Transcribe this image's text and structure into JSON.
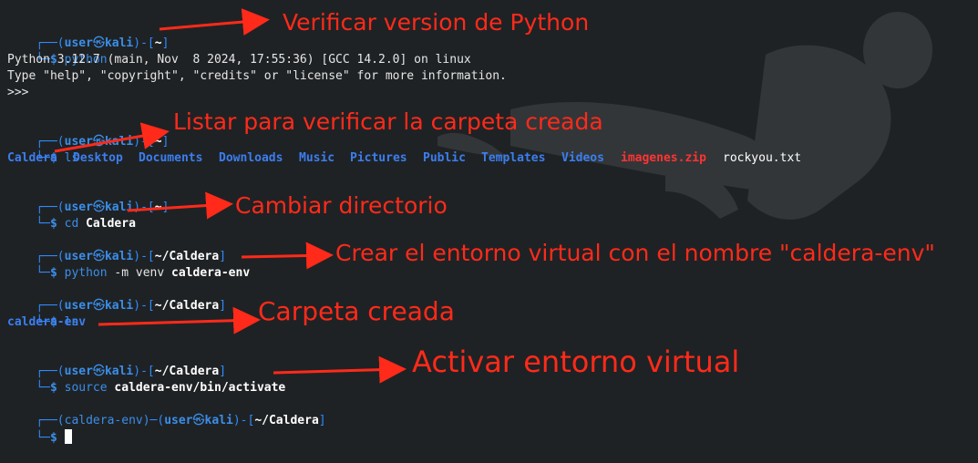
{
  "prompt": {
    "user": "user",
    "at": "㉿",
    "host": "kali",
    "venv": "(caldera-env)",
    "home": "~",
    "caldera_dir": "~/Caldera"
  },
  "blocks": {
    "b0": {
      "command": "python"
    },
    "python_out": {
      "line1": "Python 3.12.7 (main, Nov  8 2024, 17:55:36) [GCC 14.2.0] on linux",
      "line2": "Type \"help\", \"copyright\", \"credits\" or \"license\" for more information.",
      "line3": ">>>"
    },
    "b1": {
      "command": "ls"
    },
    "ls_items": [
      "Caldera",
      "Desktop",
      "Documents",
      "Downloads",
      "Music",
      "Pictures",
      "Public",
      "Templates",
      "Videos",
      "imagenes.zip",
      "rockyou.txt"
    ],
    "b2": {
      "command": "cd",
      "arg": "Caldera"
    },
    "b3": {
      "command": "python",
      "flags": "-m venv",
      "arg": "caldera-env"
    },
    "b4": {
      "command": "ls",
      "output": "caldera-env"
    },
    "b5": {
      "command": "source",
      "arg": "caldera-env/bin/activate"
    }
  },
  "annotations": {
    "a1": "Verificar version de Python",
    "a2": "Listar para verificar la carpeta creada",
    "a3": "Cambiar directorio",
    "a4": "Crear el entorno virtual con el nombre \"caldera-env\"",
    "a5": "Carpeta creada",
    "a6": "Activar entorno virtual"
  },
  "colors": {
    "background": "#1f2224",
    "prompt_blue": "#2e8bff",
    "annotation_red": "#ff2a1a",
    "zip_red": "#ff3333"
  }
}
